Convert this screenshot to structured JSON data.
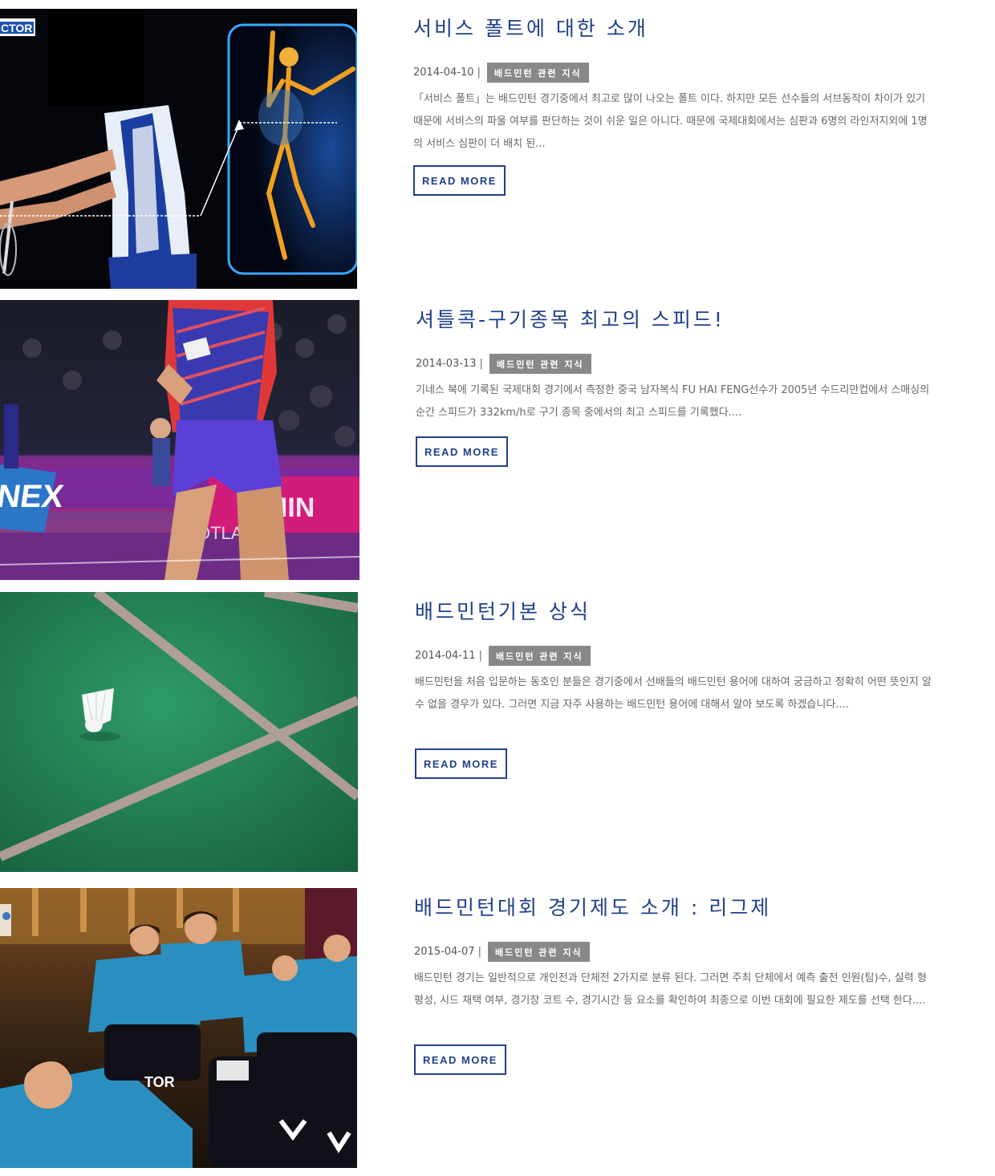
{
  "posts": [
    {
      "title": "서비스 폴트에 대한 소개",
      "date": "2014-04-10",
      "separator": "|",
      "category": "배드민턴 관련 지식",
      "excerpt": "「서비스 폴트」는 배드민턴 경기중에서 최고로 많이 나오는 폴트 이다. 하지만 모든 선수들의 서브동작이 차이가 있기 때문에 서비스의 파울 여부를 판단하는 것이 쉬운 일은 아니다. 때문에 국제대회에서는 심판과 6명의 라인저지외에 1명의 서비스 심판이 더 배치 된...",
      "read_more": "READ MORE",
      "image_text": "CTOR"
    },
    {
      "title": "셔틀콕-구기종목 최고의 스피드!",
      "date": "2014-03-13",
      "separator": "|",
      "category": "배드민턴 관련 지식",
      "excerpt": "기네스 북에 기록된 국제대회 경기에서 측정한 중국 남자복식 FU HAI FENG선수가 2005년 수드리만컵에서 스매싱의 순간 스피드가 332km/h로 구기 종목 중에서의 최고 스피드를 기록했다....",
      "read_more": "READ MORE",
      "image_text": [
        "ONEX",
        "MIN",
        "OTLAND"
      ]
    },
    {
      "title": "배드민턴기본 상식",
      "date": "2014-04-11",
      "separator": "|",
      "category": "배드민턴 관련 지식",
      "excerpt": "배드민턴을 처음 입문하는 동호인 분들은 경기중에서 선배들의 배드민턴 용어에 대하여 궁금하고 정확히 어떤 뜻인지 알 수 없을 경우가 있다. 그러면 지금 자주 사용하는 배드민턴 용어에 대해서 알아 보도록 하겠습니다....",
      "read_more": "READ MORE"
    },
    {
      "title": "배드민턴대회 경기제도 소개 : 리그제",
      "date": "2015-04-07",
      "separator": "|",
      "category": "배드민턴 관련 지식",
      "excerpt": "배드민턴 경기는 일반적으로 개인전과 단체전 2가지로 분류 된다. 그러면 주최 단체에서 예측 출전 인원(팀)수, 실력 형평성, 시드 채택 여부, 경기장 코트 수, 경기시간 등 요소를 확인하여 최종으로 이번 대회에 필요한 제도를 선택 한다....",
      "read_more": "READ MORE",
      "image_text": "TOR"
    }
  ],
  "colors": {
    "title": "#1f3f8c",
    "category_bg": "#888888",
    "text": "#666666",
    "button_border": "#1f3f8c"
  }
}
